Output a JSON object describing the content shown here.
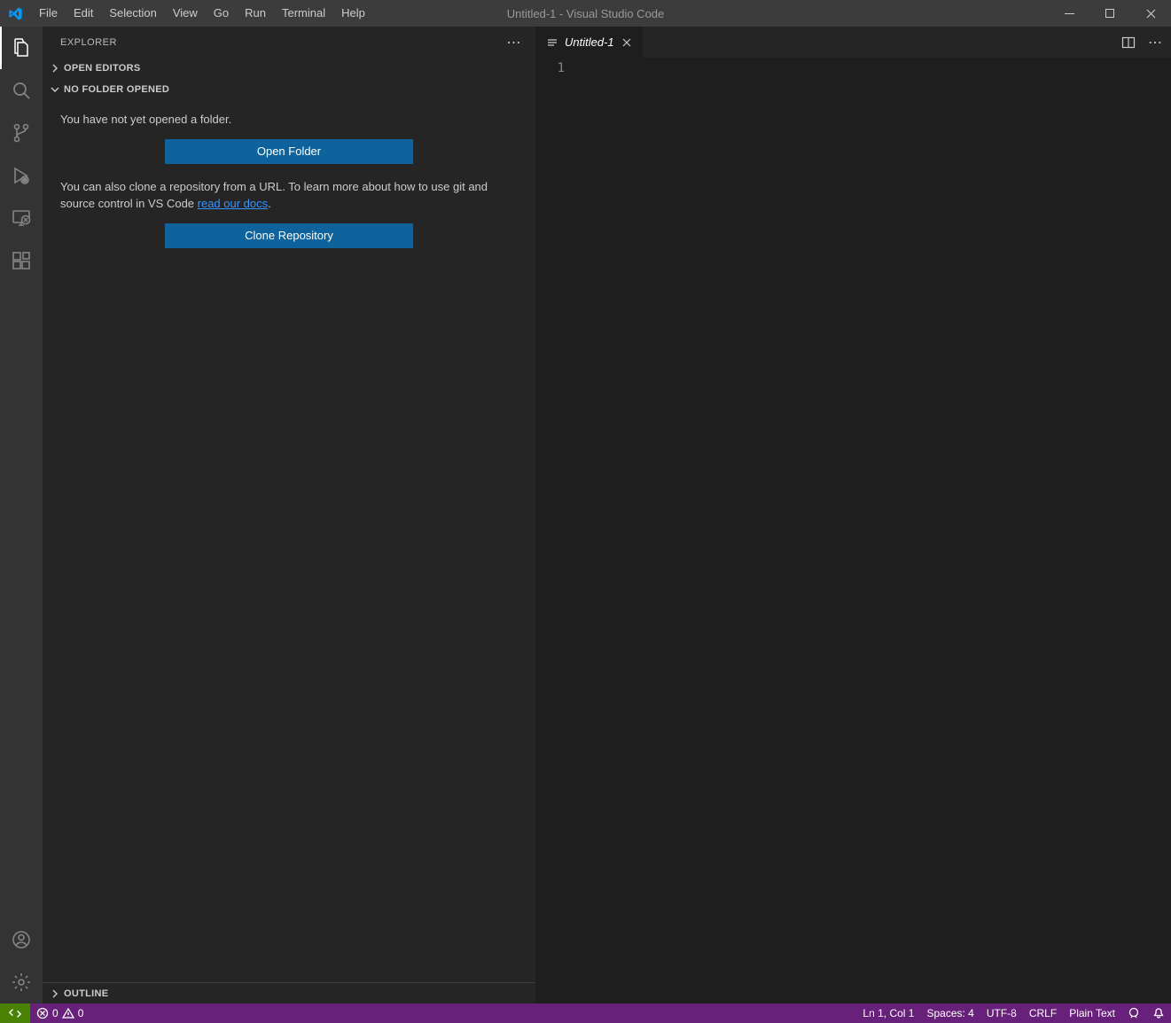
{
  "titlebar": {
    "title": "Untitled-1 - Visual Studio Code",
    "menus": [
      "File",
      "Edit",
      "Selection",
      "View",
      "Go",
      "Run",
      "Terminal",
      "Help"
    ]
  },
  "activitybar": {
    "items": [
      {
        "name": "explorer",
        "icon": "files-icon",
        "active": true
      },
      {
        "name": "search",
        "icon": "search-icon",
        "active": false
      },
      {
        "name": "source-control",
        "icon": "source-control-icon",
        "active": false
      },
      {
        "name": "run-debug",
        "icon": "debug-icon",
        "active": false
      },
      {
        "name": "remote-explorer",
        "icon": "remote-icon",
        "active": false
      },
      {
        "name": "extensions",
        "icon": "extensions-icon",
        "active": false
      }
    ],
    "bottom": [
      {
        "name": "accounts",
        "icon": "account-icon"
      },
      {
        "name": "manage",
        "icon": "gear-icon"
      }
    ]
  },
  "sidebar": {
    "title": "EXPLORER",
    "open_editors_label": "OPEN EDITORS",
    "no_folder_label": "NO FOLDER OPENED",
    "not_opened_text": "You have not yet opened a folder.",
    "open_folder_btn": "Open Folder",
    "clone_text_a": "You can also clone a repository from a URL. To learn more about how to use git and source control in VS Code ",
    "clone_link": "read our docs",
    "clone_text_b": ".",
    "clone_repo_btn": "Clone Repository",
    "outline_label": "OUTLINE"
  },
  "editor": {
    "tab_name": "Untitled-1",
    "gutter_first_line": "1"
  },
  "statusbar": {
    "errors": "0",
    "warnings": "0",
    "cursor": "Ln 1, Col 1",
    "spaces": "Spaces: 4",
    "encoding": "UTF-8",
    "eol": "CRLF",
    "language": "Plain Text"
  },
  "colors": {
    "accent_purple": "#68217a",
    "accent_green": "#498205",
    "button_blue": "#0e639c",
    "link_blue": "#3794ff"
  }
}
